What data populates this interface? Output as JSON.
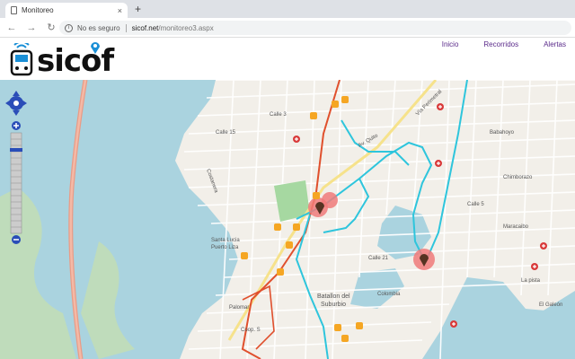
{
  "browser": {
    "tab_title": "Monitoreo",
    "tab_close": "×",
    "new_tab": "+",
    "back": "←",
    "forward": "→",
    "reload": "↻",
    "info_glyph": "i",
    "security_text": "No es seguro",
    "url_host": "sicof.net",
    "url_path": "/monitoreo3.aspx"
  },
  "app": {
    "logo_text": "sicof",
    "nav": [
      "Inicio",
      "Recorridos",
      "Alertas"
    ]
  },
  "map": {
    "labels": [
      "Batallon del",
      "Suburbio",
      "Coop. S",
      "Palomar",
      "Santa Lucia",
      "Puerto Liza",
      "Calle 15",
      "Calle 21",
      "Calle 3",
      "Calle 5",
      "Chimborazo",
      "Babahoyo",
      "Colombia",
      "La pista",
      "El Galeón",
      "Vía Perimetral",
      "Av. Quito",
      "Maracaibo",
      "Costanera"
    ],
    "colors": {
      "route_cyan": "#2ec5dc",
      "route_red": "#e0502d",
      "water": "#aad3df",
      "park": "#a6d8a1",
      "alert": "#f07a7a"
    },
    "icons": [
      "zoom-in-icon",
      "zoom-out-icon",
      "pan-icon",
      "bus-stop-icon",
      "alert-marker-icon",
      "hospital-icon"
    ]
  }
}
